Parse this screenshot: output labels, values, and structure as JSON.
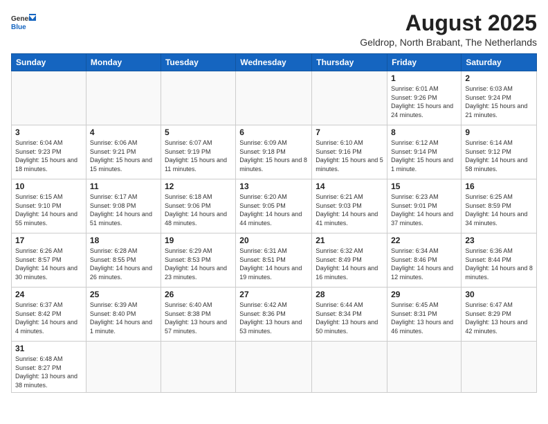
{
  "header": {
    "logo_general": "General",
    "logo_blue": "Blue",
    "month_title": "August 2025",
    "subtitle": "Geldrop, North Brabant, The Netherlands"
  },
  "weekdays": [
    "Sunday",
    "Monday",
    "Tuesday",
    "Wednesday",
    "Thursday",
    "Friday",
    "Saturday"
  ],
  "weeks": [
    [
      {
        "day": "",
        "info": ""
      },
      {
        "day": "",
        "info": ""
      },
      {
        "day": "",
        "info": ""
      },
      {
        "day": "",
        "info": ""
      },
      {
        "day": "",
        "info": ""
      },
      {
        "day": "1",
        "info": "Sunrise: 6:01 AM\nSunset: 9:26 PM\nDaylight: 15 hours\nand 24 minutes."
      },
      {
        "day": "2",
        "info": "Sunrise: 6:03 AM\nSunset: 9:24 PM\nDaylight: 15 hours\nand 21 minutes."
      }
    ],
    [
      {
        "day": "3",
        "info": "Sunrise: 6:04 AM\nSunset: 9:23 PM\nDaylight: 15 hours\nand 18 minutes."
      },
      {
        "day": "4",
        "info": "Sunrise: 6:06 AM\nSunset: 9:21 PM\nDaylight: 15 hours\nand 15 minutes."
      },
      {
        "day": "5",
        "info": "Sunrise: 6:07 AM\nSunset: 9:19 PM\nDaylight: 15 hours\nand 11 minutes."
      },
      {
        "day": "6",
        "info": "Sunrise: 6:09 AM\nSunset: 9:18 PM\nDaylight: 15 hours\nand 8 minutes."
      },
      {
        "day": "7",
        "info": "Sunrise: 6:10 AM\nSunset: 9:16 PM\nDaylight: 15 hours\nand 5 minutes."
      },
      {
        "day": "8",
        "info": "Sunrise: 6:12 AM\nSunset: 9:14 PM\nDaylight: 15 hours\nand 1 minute."
      },
      {
        "day": "9",
        "info": "Sunrise: 6:14 AM\nSunset: 9:12 PM\nDaylight: 14 hours\nand 58 minutes."
      }
    ],
    [
      {
        "day": "10",
        "info": "Sunrise: 6:15 AM\nSunset: 9:10 PM\nDaylight: 14 hours\nand 55 minutes."
      },
      {
        "day": "11",
        "info": "Sunrise: 6:17 AM\nSunset: 9:08 PM\nDaylight: 14 hours\nand 51 minutes."
      },
      {
        "day": "12",
        "info": "Sunrise: 6:18 AM\nSunset: 9:06 PM\nDaylight: 14 hours\nand 48 minutes."
      },
      {
        "day": "13",
        "info": "Sunrise: 6:20 AM\nSunset: 9:05 PM\nDaylight: 14 hours\nand 44 minutes."
      },
      {
        "day": "14",
        "info": "Sunrise: 6:21 AM\nSunset: 9:03 PM\nDaylight: 14 hours\nand 41 minutes."
      },
      {
        "day": "15",
        "info": "Sunrise: 6:23 AM\nSunset: 9:01 PM\nDaylight: 14 hours\nand 37 minutes."
      },
      {
        "day": "16",
        "info": "Sunrise: 6:25 AM\nSunset: 8:59 PM\nDaylight: 14 hours\nand 34 minutes."
      }
    ],
    [
      {
        "day": "17",
        "info": "Sunrise: 6:26 AM\nSunset: 8:57 PM\nDaylight: 14 hours\nand 30 minutes."
      },
      {
        "day": "18",
        "info": "Sunrise: 6:28 AM\nSunset: 8:55 PM\nDaylight: 14 hours\nand 26 minutes."
      },
      {
        "day": "19",
        "info": "Sunrise: 6:29 AM\nSunset: 8:53 PM\nDaylight: 14 hours\nand 23 minutes."
      },
      {
        "day": "20",
        "info": "Sunrise: 6:31 AM\nSunset: 8:51 PM\nDaylight: 14 hours\nand 19 minutes."
      },
      {
        "day": "21",
        "info": "Sunrise: 6:32 AM\nSunset: 8:49 PM\nDaylight: 14 hours\nand 16 minutes."
      },
      {
        "day": "22",
        "info": "Sunrise: 6:34 AM\nSunset: 8:46 PM\nDaylight: 14 hours\nand 12 minutes."
      },
      {
        "day": "23",
        "info": "Sunrise: 6:36 AM\nSunset: 8:44 PM\nDaylight: 14 hours\nand 8 minutes."
      }
    ],
    [
      {
        "day": "24",
        "info": "Sunrise: 6:37 AM\nSunset: 8:42 PM\nDaylight: 14 hours\nand 4 minutes."
      },
      {
        "day": "25",
        "info": "Sunrise: 6:39 AM\nSunset: 8:40 PM\nDaylight: 14 hours\nand 1 minute."
      },
      {
        "day": "26",
        "info": "Sunrise: 6:40 AM\nSunset: 8:38 PM\nDaylight: 13 hours\nand 57 minutes."
      },
      {
        "day": "27",
        "info": "Sunrise: 6:42 AM\nSunset: 8:36 PM\nDaylight: 13 hours\nand 53 minutes."
      },
      {
        "day": "28",
        "info": "Sunrise: 6:44 AM\nSunset: 8:34 PM\nDaylight: 13 hours\nand 50 minutes."
      },
      {
        "day": "29",
        "info": "Sunrise: 6:45 AM\nSunset: 8:31 PM\nDaylight: 13 hours\nand 46 minutes."
      },
      {
        "day": "30",
        "info": "Sunrise: 6:47 AM\nSunset: 8:29 PM\nDaylight: 13 hours\nand 42 minutes."
      }
    ],
    [
      {
        "day": "31",
        "info": "Sunrise: 6:48 AM\nSunset: 8:27 PM\nDaylight: 13 hours\nand 38 minutes."
      },
      {
        "day": "",
        "info": ""
      },
      {
        "day": "",
        "info": ""
      },
      {
        "day": "",
        "info": ""
      },
      {
        "day": "",
        "info": ""
      },
      {
        "day": "",
        "info": ""
      },
      {
        "day": "",
        "info": ""
      }
    ]
  ]
}
